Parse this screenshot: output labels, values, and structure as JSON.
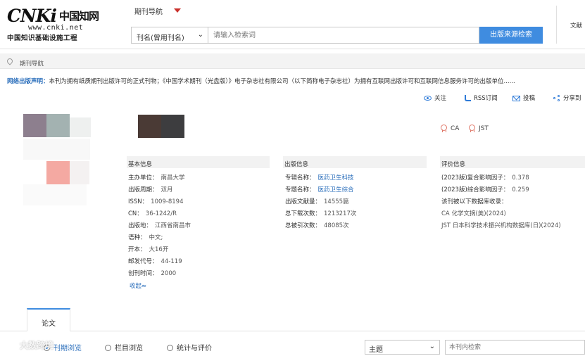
{
  "header": {
    "logo": {
      "main": "CNKi",
      "cn": "中国知网",
      "url": "www.cnki.net",
      "subtitle": "中国知识基础设施工程"
    },
    "nav_title": "期刊导航",
    "search": {
      "field": "刊名(曾用刊名)",
      "placeholder": "请输入检索词",
      "button": "出版来源检索"
    },
    "right_link": "文献"
  },
  "breadcrumb": "期刊导航",
  "notice": {
    "label": "网络出版声明：",
    "text": "本刊为拥有纸质期刊出版许可的正式刊物；《中国学术期刊（光盘版）》电子杂志社有限公司（以下简称电子杂志社）为拥有互联网出版许可和互联网信息服务许可的出版单位......"
  },
  "actions": {
    "follow": "关注",
    "rss": "RSS订阅",
    "submit": "投稿",
    "share": "分享到"
  },
  "badges": [
    "CA",
    "JST"
  ],
  "basic_info": {
    "heading": "基本信息",
    "rows": [
      {
        "k": "主办单位：",
        "v": "南昌大学"
      },
      {
        "k": "出版周期：",
        "v": "双月"
      },
      {
        "k": "ISSN：",
        "v": "1009-8194"
      },
      {
        "k": "CN：",
        "v": "36-1242/R"
      },
      {
        "k": "出版地：",
        "v": "江西省南昌市"
      },
      {
        "k": "语种：",
        "v": "中文;"
      },
      {
        "k": "开本：",
        "v": "大16开"
      },
      {
        "k": "邮发代号：",
        "v": "44-119"
      },
      {
        "k": "创刊时间：",
        "v": "2000"
      }
    ],
    "collapse": "收起≈"
  },
  "publish_info": {
    "heading": "出版信息",
    "rows": [
      {
        "k": "专辑名称：",
        "v": "医药卫生科技"
      },
      {
        "k": "专题名称：",
        "v": "医药卫生综合"
      },
      {
        "k": "出版文献量：",
        "v": "14555篇"
      },
      {
        "k": "总下载次数：",
        "v": "1213217次"
      },
      {
        "k": "总被引次数：",
        "v": "48085次"
      }
    ]
  },
  "eval_info": {
    "heading": "评价信息",
    "rows": [
      {
        "k": "(2023版)复合影响因子：",
        "v": "0.378"
      },
      {
        "k": "(2023版)综合影响因子：",
        "v": "0.259"
      },
      {
        "k": "该刊被以下数据库收录：",
        "v": ""
      },
      {
        "k": "CA 化学文摘(美)(2024)",
        "v": ""
      },
      {
        "k": "JST 日本科学技术振兴机构数据库(日)(2024)",
        "v": ""
      }
    ]
  },
  "tabs": {
    "active": "论文"
  },
  "browse": {
    "options": [
      "刊期浏览",
      "栏目浏览",
      "统计与评价"
    ],
    "select": "主题",
    "search_placeholder": "本刊内检索"
  },
  "watermark": "大数跨境",
  "colors": {
    "accent": "#3f8ce0",
    "link": "#2a6ebb",
    "caret": "#c9302c",
    "medal": "#e07a6b"
  }
}
